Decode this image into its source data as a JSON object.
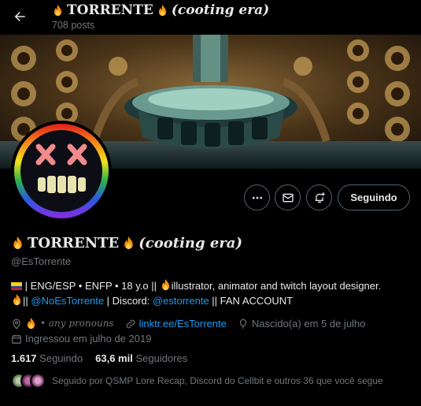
{
  "header": {
    "title_name": "TORRENTE",
    "title_suffix": "(cooting era)",
    "posts": "708 posts"
  },
  "profile": {
    "name": "TORRENTE",
    "name_suffix": "(cooting era)",
    "handle": "@EsTorrente",
    "bio_line1": "| ENG/ESP • ENFP • 18 y.o || ",
    "bio_line1b": "illustrator, animator and twitch layout designer.",
    "bio_line2a": "|| ",
    "bio_mention1": "@NoEsTorrente",
    "bio_line2b": " | Discord: ",
    "bio_mention2": "@estorrente",
    "bio_line2c": " || FAN ACCOUNT",
    "location": "• any pronouns",
    "website": "linktr.ee/EsTorrente",
    "birthday": "Nascido(a) em 5 de julho",
    "joined": "Ingressou em julho de 2019",
    "following_count": "1.617",
    "following_label": "Seguindo",
    "followers_count": "63,6 mil",
    "followers_label": "Seguidores",
    "followed_by": "Seguido por QSMP Lore Recap, Discord do Cellbit e outros 36 que você segue"
  },
  "actions": {
    "follow_label": "Seguindo"
  },
  "colors": {
    "link": "#1d9bf0",
    "muted": "#71767b",
    "text": "#e7e9ea"
  }
}
